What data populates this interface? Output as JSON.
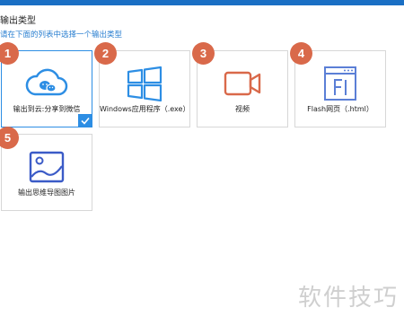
{
  "header": {
    "title": "输出类型",
    "subtitle": "请在下面的列表中选择一个输出类型"
  },
  "options": [
    {
      "badge": "1",
      "label": "输出到云:分享到微信",
      "icon": "cloud-icon",
      "selected": true
    },
    {
      "badge": "2",
      "label": "Windows应用程序（.exe）",
      "icon": "windows-icon",
      "selected": false
    },
    {
      "badge": "3",
      "label": "视频",
      "icon": "video-icon",
      "selected": false
    },
    {
      "badge": "4",
      "label": "Flash网页（.html）",
      "icon": "flash-icon",
      "selected": false
    },
    {
      "badge": "5",
      "label": "输出思维导图图片",
      "icon": "image-icon",
      "selected": false
    }
  ],
  "watermark": "软件技巧",
  "colors": {
    "accent": "#2d8ee4",
    "badge": "#d9694a",
    "video": "#d9694a",
    "top_bar": "#1a6fc4"
  }
}
